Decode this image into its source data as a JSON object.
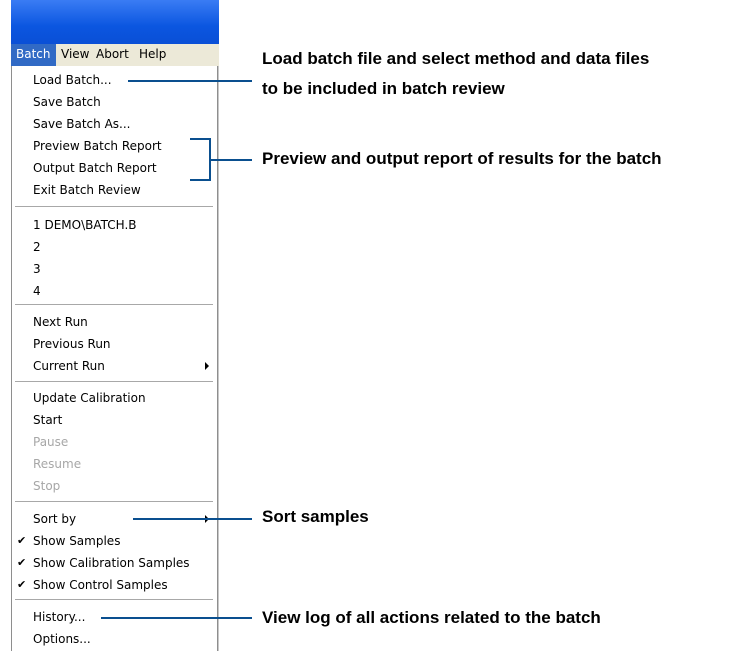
{
  "menubar": {
    "items": [
      {
        "label": "Batch"
      },
      {
        "label": "View"
      },
      {
        "label": "Abort"
      },
      {
        "label": "Help"
      }
    ]
  },
  "menu": {
    "load_batch": "Load Batch...",
    "save_batch": "Save Batch",
    "save_batch_as": "Save Batch As...",
    "preview_report": "Preview Batch Report",
    "output_report": "Output Batch Report",
    "exit_review": "Exit Batch Review",
    "recent_1": "1 DEMO\\BATCH.B",
    "recent_2": "2",
    "recent_3": "3",
    "recent_4": "4",
    "next_run": "Next Run",
    "previous_run": "Previous Run",
    "current_run": "Current Run",
    "update_calibration": "Update Calibration",
    "start": "Start",
    "pause": "Pause",
    "resume": "Resume",
    "stop": "Stop",
    "sort_by": "Sort by",
    "show_samples": "Show Samples",
    "show_calibration_samples": "Show Calibration Samples",
    "show_control_samples": "Show Control Samples",
    "history": "History...",
    "options": "Options...",
    "check_mark": "✔"
  },
  "callouts": {
    "load_line1": "Load batch file and select method and data files",
    "load_line2": "to be included in batch review",
    "report": "Preview and output report of results for the batch",
    "sort": "Sort samples",
    "history": "View log of all actions related to the batch"
  },
  "colors": {
    "titlebar": "#0b56e0",
    "menu_highlight": "#316ac5",
    "leader": "#0a4f8f",
    "disabled_text": "#a7a7a7"
  }
}
